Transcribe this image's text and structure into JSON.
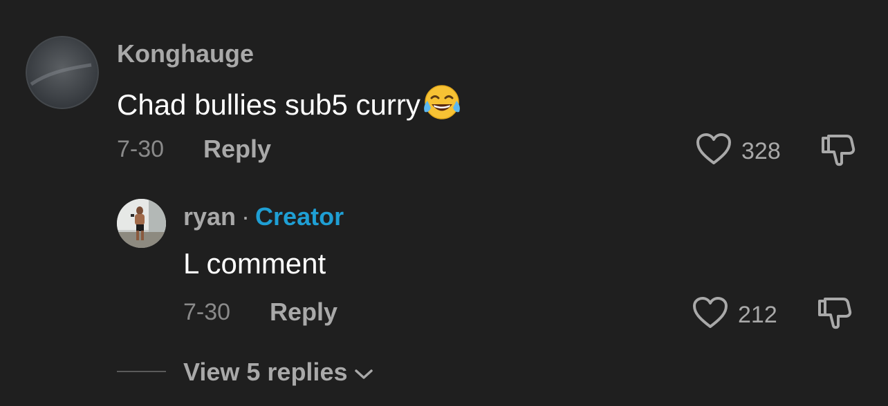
{
  "comment": {
    "username": "Konghauge",
    "text": "Chad bullies sub5 curry",
    "emoji": "face-with-tears-of-joy",
    "date": "7-30",
    "reply_label": "Reply",
    "like_count": "328"
  },
  "reply": {
    "username": "ryan",
    "separator": "·",
    "badge": "Creator",
    "text": "L comment",
    "date": "7-30",
    "reply_label": "Reply",
    "like_count": "212"
  },
  "view_replies_label": "View 5 replies",
  "colors": {
    "background": "#1f1f1f",
    "creator_badge": "#1f9fd4",
    "muted_text": "#a9a9a9"
  }
}
